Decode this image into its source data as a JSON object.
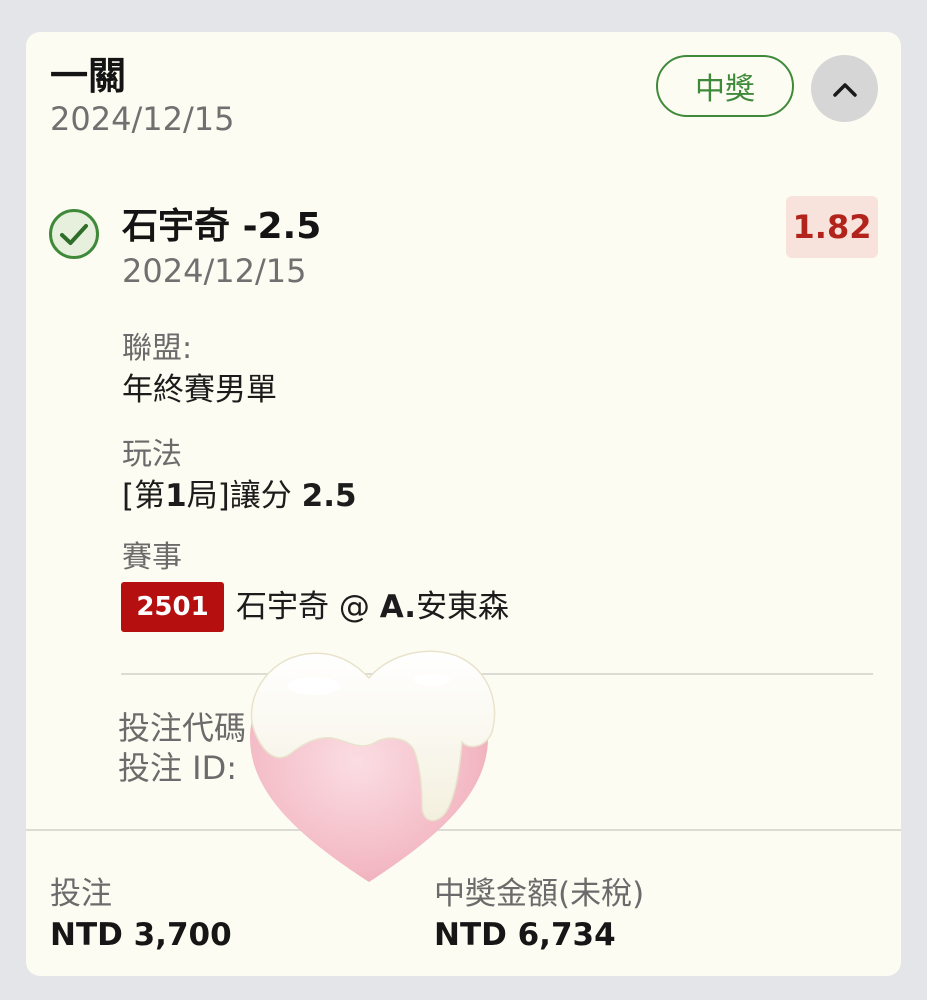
{
  "header": {
    "title": "一關",
    "date": "2024/12/15",
    "status_badge": "中獎"
  },
  "selection": {
    "title_name": "石宇奇",
    "title_line": "-2.5",
    "date": "2024/12/15",
    "odds": "1.82",
    "odds_color": "#b2231c"
  },
  "details": {
    "league_label": "聯盟:",
    "league_value": "年終賽男單",
    "bet_type_label": "玩法",
    "bet_type_prefix": "[第",
    "bet_type_num": "1",
    "bet_type_mid": "局]讓分 ",
    "bet_type_line": "2.5",
    "event_label": "賽事",
    "event_code": "2501",
    "event_home": "石宇奇 @ ",
    "event_away_initial": "A.",
    "event_away_name": "安東森"
  },
  "ids": {
    "bet_code_label": "投注代碼",
    "bet_id_label": "投注 ID:"
  },
  "footer": {
    "stake_label": "投注",
    "stake_value": "NTD 3,700",
    "payout_label": "中獎金額(未稅)",
    "payout_value": "NTD 6,734"
  },
  "colors": {
    "accent_green": "#3f8a3a",
    "event_red": "#b50f10",
    "card_bg": "#fdfcf2"
  },
  "icons": {
    "collapse": "chevron-up-icon",
    "check": "check-circle-icon",
    "sticker": "heart-sticker-icon"
  }
}
